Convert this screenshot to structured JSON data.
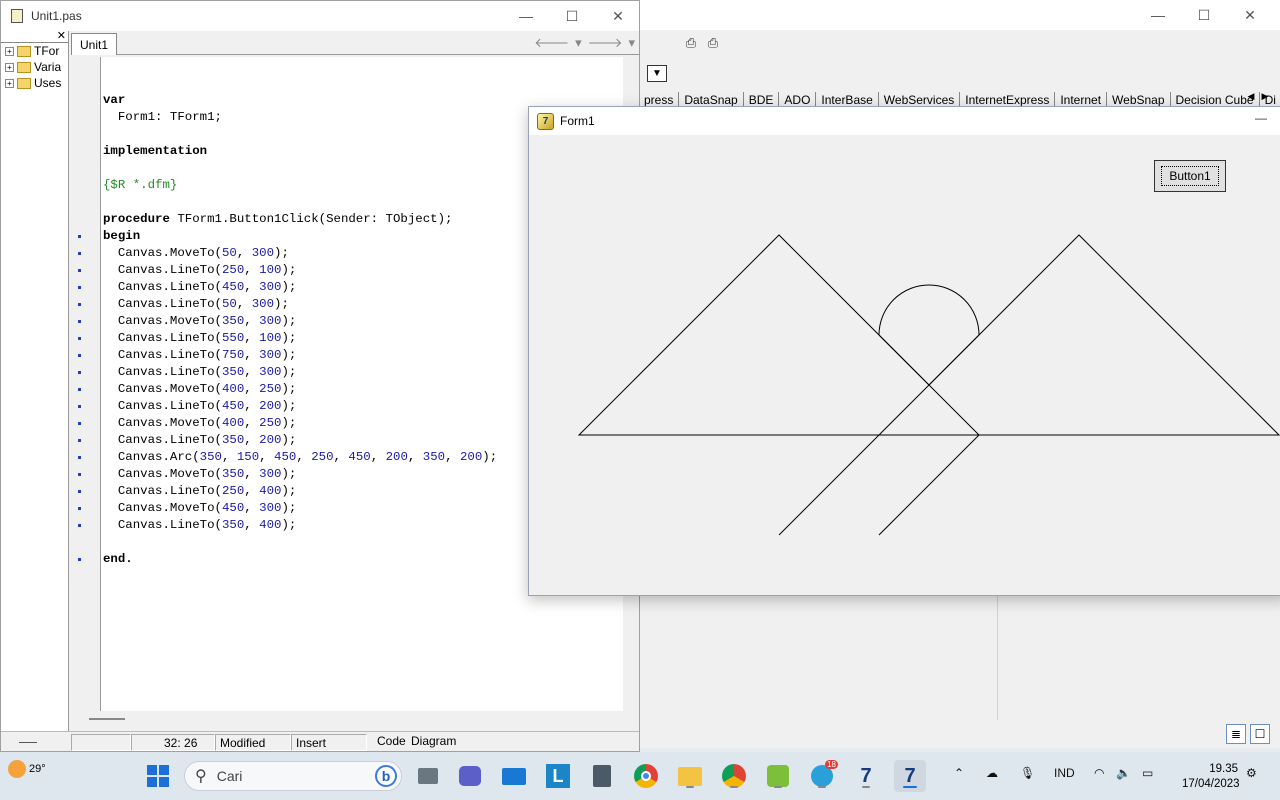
{
  "editor": {
    "title": "Unit1.pas",
    "tab": "Unit1",
    "explorer_items": [
      "TFor",
      "Varia",
      "Uses"
    ],
    "code_lines": [
      {
        "t": "",
        "dot": false
      },
      {
        "t": "var",
        "dot": false,
        "kw": true
      },
      {
        "t": "  Form1: TForm1;",
        "dot": false
      },
      {
        "t": "",
        "dot": false
      },
      {
        "t": "implementation",
        "dot": false,
        "kw": true
      },
      {
        "t": "",
        "dot": false
      },
      {
        "t": "{$R *.dfm}",
        "dot": false,
        "dir": true
      },
      {
        "t": "",
        "dot": false
      },
      {
        "t": "procedure TForm1.Button1Click(Sender: TObject);",
        "dot": false,
        "kw2": true
      },
      {
        "t": "begin",
        "dot": true,
        "kw": true
      },
      {
        "t": "  Canvas.MoveTo(50, 300);",
        "dot": true
      },
      {
        "t": "  Canvas.LineTo(250, 100);",
        "dot": true
      },
      {
        "t": "  Canvas.LineTo(450, 300);",
        "dot": true
      },
      {
        "t": "  Canvas.LineTo(50, 300);",
        "dot": true
      },
      {
        "t": "  Canvas.MoveTo(350, 300);",
        "dot": true
      },
      {
        "t": "  Canvas.LineTo(550, 100);",
        "dot": true
      },
      {
        "t": "  Canvas.LineTo(750, 300);",
        "dot": true
      },
      {
        "t": "  Canvas.LineTo(350, 300);",
        "dot": true
      },
      {
        "t": "  Canvas.MoveTo(400, 250);",
        "dot": true
      },
      {
        "t": "  Canvas.LineTo(450, 200);",
        "dot": true
      },
      {
        "t": "  Canvas.MoveTo(400, 250);",
        "dot": true
      },
      {
        "t": "  Canvas.LineTo(350, 200);",
        "dot": true
      },
      {
        "t": "  Canvas.Arc(350, 150, 450, 250, 450, 200, 350, 200);",
        "dot": true
      },
      {
        "t": "  Canvas.MoveTo(350, 300);",
        "dot": true
      },
      {
        "t": "  Canvas.LineTo(250, 400);",
        "dot": true
      },
      {
        "t": "  Canvas.MoveTo(450, 300);",
        "dot": true
      },
      {
        "t": "  Canvas.LineTo(350, 400);",
        "dot": true
      },
      {
        "t": "",
        "dot": false
      },
      {
        "t": "end.",
        "dot": true,
        "kw": true
      }
    ],
    "status": {
      "position": "32: 26",
      "modified": "Modified",
      "mode": "Insert",
      "tab_code": "Code",
      "tab_diagram": "Diagram"
    }
  },
  "ide": {
    "palette_tabs": [
      "press",
      "DataSnap",
      "BDE",
      "ADO",
      "InterBase",
      "WebServices",
      "InternetExpress",
      "Internet",
      "WebSnap",
      "Decision Cube",
      "Di"
    ]
  },
  "form1": {
    "title": "Form1",
    "button_label": "Button1"
  },
  "taskbar": {
    "temperature": "29°",
    "search_placeholder": "Cari",
    "telegram_badge": "18",
    "language": "IND",
    "time": "19.35",
    "date": "17/04/2023"
  }
}
